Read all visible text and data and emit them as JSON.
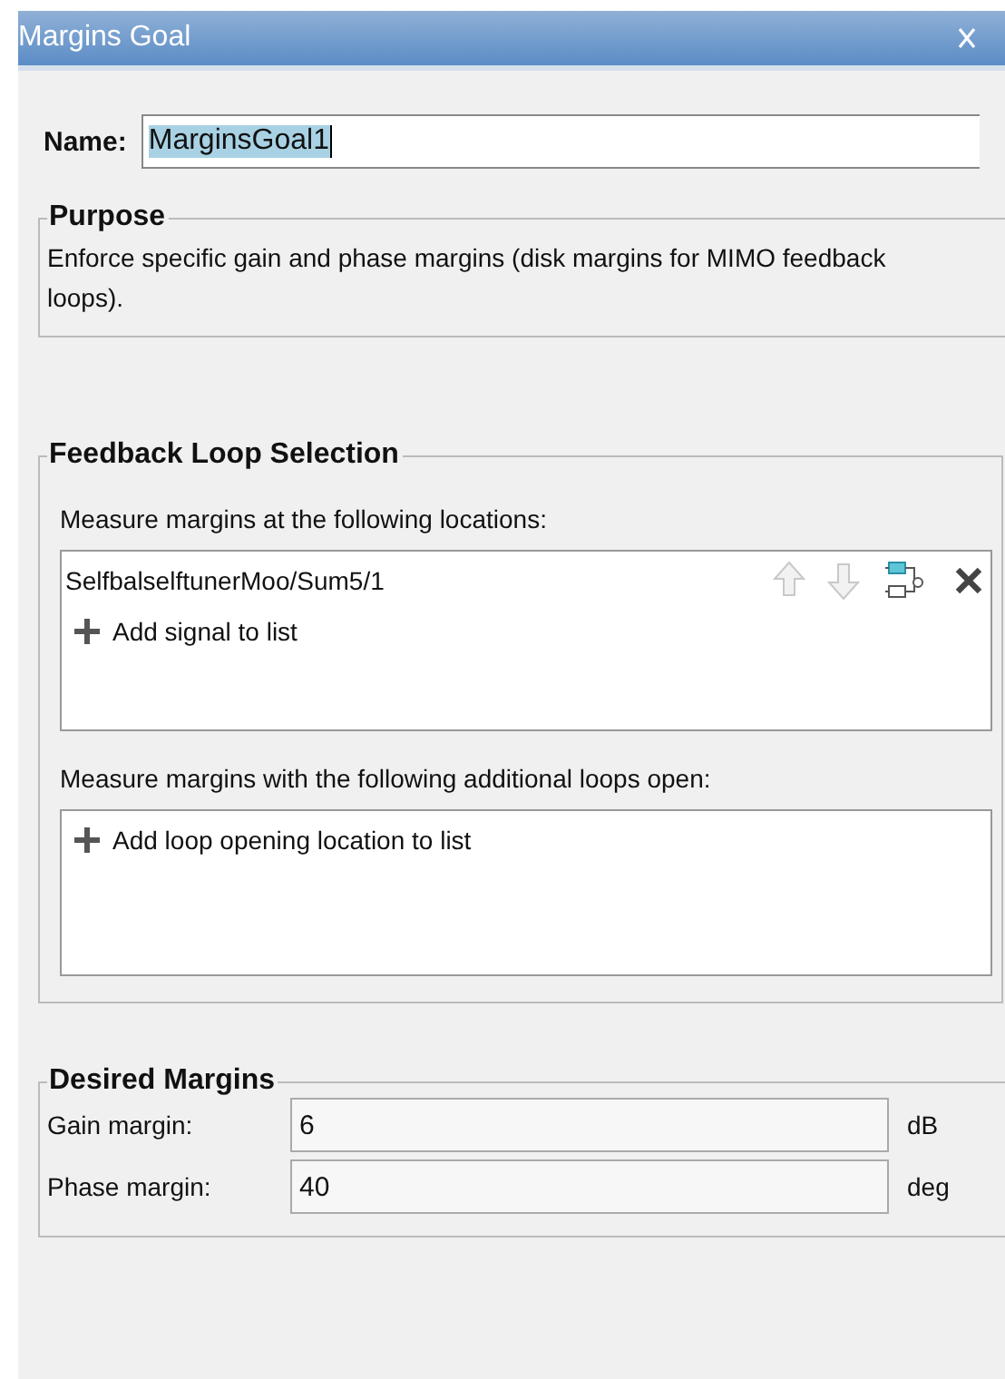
{
  "window": {
    "title": "Margins Goal"
  },
  "name": {
    "label": "Name:",
    "value": "MarginsGoal1"
  },
  "purpose": {
    "title": "Purpose",
    "text": "Enforce specific gain and phase margins (disk margins for MIMO feedback loops)."
  },
  "feedback": {
    "title": "Feedback Loop Selection",
    "locations": {
      "label": "Measure margins at the following locations:",
      "items": [
        {
          "text": "SelfbalselftunerMoo/Sum5/1"
        }
      ],
      "add": "Add signal to list"
    },
    "openings": {
      "label": "Measure margins with the following additional loops open:",
      "add": "Add loop opening location to list"
    }
  },
  "margins": {
    "title": "Desired Margins",
    "fields": [
      {
        "label": "Gain margin:",
        "value": "6",
        "unit": "dB"
      },
      {
        "label": "Phase margin:",
        "value": "40",
        "unit": "deg"
      }
    ]
  }
}
